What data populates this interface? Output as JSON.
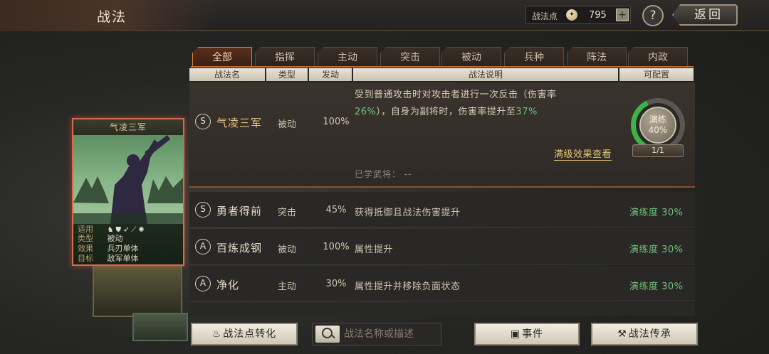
{
  "header": {
    "title": "战法",
    "points_label": "战法点",
    "points_value": "795",
    "add_label": "+",
    "help_label": "?",
    "back_label": "返回"
  },
  "card": {
    "title": "气凌三军",
    "rows": [
      {
        "key": "适用",
        "value": ""
      },
      {
        "key": "类型",
        "value": "被动"
      },
      {
        "key": "效果",
        "value": "兵刃单体"
      },
      {
        "key": "目标",
        "value": "敌军单体"
      }
    ],
    "unit_icons": [
      "cavalry-icon",
      "shield-icon",
      "archer-icon",
      "spear-icon",
      "siege-icon"
    ]
  },
  "tabs": [
    {
      "label": "全部",
      "active": true
    },
    {
      "label": "指挥",
      "active": false
    },
    {
      "label": "主动",
      "active": false
    },
    {
      "label": "突击",
      "active": false
    },
    {
      "label": "被动",
      "active": false
    },
    {
      "label": "兵种",
      "active": false
    },
    {
      "label": "阵法",
      "active": false
    },
    {
      "label": "内政",
      "active": false
    }
  ],
  "columns": [
    "战法名",
    "类型",
    "发动",
    "战法说明",
    "可配置"
  ],
  "expanded": {
    "grade": "S",
    "name": "气凌三军",
    "type": "被动",
    "rate": "100%",
    "desc_line1": "受到普通攻击时对攻击者进行一次反击（伤害率",
    "desc_line2_pct1": "26%",
    "desc_line2_mid": "），自身为副将时，伤害率提升至",
    "desc_line2_pct2": "37%",
    "view_link": "满级效果查看",
    "learned_label": "已学武将：",
    "learned_value": "--",
    "train_label": "演练",
    "train_percent": "40%",
    "train_progress": 0.4,
    "slot": "1/1"
  },
  "rows": [
    {
      "grade": "S",
      "name": "勇者得前",
      "type": "突击",
      "rate": "45%",
      "desc": "获得抵御且战法伤害提升",
      "training": "演练度 30%"
    },
    {
      "grade": "A",
      "name": "百炼成钢",
      "type": "被动",
      "rate": "100%",
      "desc": "属性提升",
      "training": "演练度 30%"
    },
    {
      "grade": "A",
      "name": "净化",
      "type": "主动",
      "rate": "30%",
      "desc": "属性提升并移除负面状态",
      "training": "演练度 30%"
    }
  ],
  "bottom": {
    "convert_label": "战法点转化",
    "search_placeholder": "战法名称或描述",
    "event_label": "事件",
    "inherit_label": "战法传承"
  },
  "colors": {
    "accent": "#d8843e",
    "highlight_green": "#6fc27a",
    "link_gold": "#e7c476"
  }
}
